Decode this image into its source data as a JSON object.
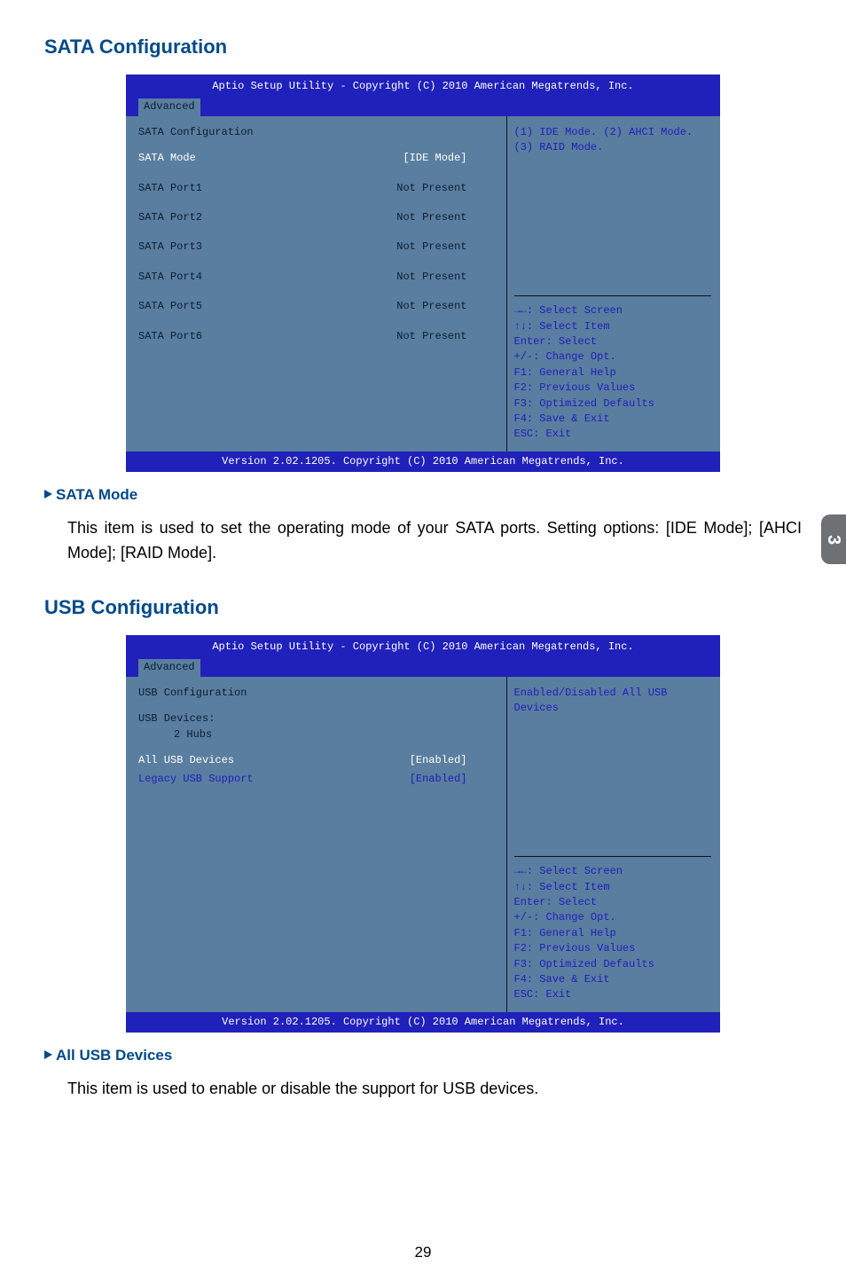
{
  "headings": {
    "sata": "SATA Configuration",
    "usb": "USB Configuration"
  },
  "bios_common": {
    "header": "Aptio Setup Utility - Copyright (C) 2010 American Megatrends, Inc.",
    "tab": "Advanced",
    "footer": "Version 2.02.1205. Copyright (C) 2010 American Megatrends, Inc.",
    "help": {
      "select_screen": ": Select Screen",
      "select_item": ": Select Item",
      "enter": "Enter: Select",
      "change": "+/-: Change Opt.",
      "f1": "F1: General Help",
      "f2": "F2: Previous Values",
      "f3": "F3: Optimized Defaults",
      "f4": "F4: Save & Exit",
      "esc": "ESC: Exit"
    }
  },
  "sata_bios": {
    "section": "SATA Configuration",
    "mode_label": "SATA Mode",
    "mode_value": "[IDE Mode]",
    "ports": [
      {
        "label": "SATA Port1",
        "value": "Not Present"
      },
      {
        "label": "SATA Port2",
        "value": "Not Present"
      },
      {
        "label": "SATA Port3",
        "value": "Not Present"
      },
      {
        "label": "SATA Port4",
        "value": "Not Present"
      },
      {
        "label": "SATA Port5",
        "value": "Not Present"
      },
      {
        "label": "SATA Port6",
        "value": "Not Present"
      }
    ],
    "desc": "(1) IDE Mode. (2) AHCI Mode. (3) RAID Mode."
  },
  "usb_bios": {
    "section": "USB Configuration",
    "devices_label": "USB Devices:",
    "devices_value": "2 Hubs",
    "items": [
      {
        "label": "All USB Devices",
        "value": "[Enabled]"
      },
      {
        "label": "Legacy USB Support",
        "value": "[Enabled]"
      }
    ],
    "desc": "Enabled/Disabled All USB Devices"
  },
  "subs": {
    "sata_mode": {
      "title": "SATA Mode",
      "body": "This item is used to set the operating mode of your SATA ports. Setting options: [IDE Mode]; [AHCI Mode]; [RAID Mode]."
    },
    "all_usb": {
      "title": "All USB Devices",
      "body": "This item is used to enable or disable the support for USB devices."
    }
  },
  "page_tab": "3",
  "page_num": "29"
}
